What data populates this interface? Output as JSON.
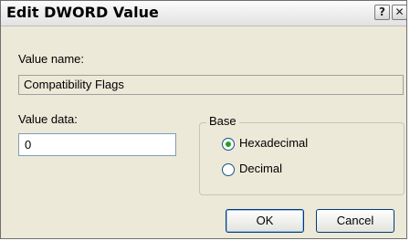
{
  "window": {
    "title": "Edit DWORD Value",
    "help_glyph": "?",
    "close_glyph": "✕"
  },
  "value_name": {
    "label": "Value name:",
    "value": "Compatibility Flags"
  },
  "value_data": {
    "label": "Value data:",
    "value": "0"
  },
  "base": {
    "legend": "Base",
    "options": [
      {
        "label": "Hexadecimal",
        "selected": true
      },
      {
        "label": "Decimal",
        "selected": false
      }
    ]
  },
  "buttons": {
    "ok": "OK",
    "cancel": "Cancel"
  },
  "colors": {
    "dialog_bg": "#ece9d8",
    "radio_dot": "#21a121",
    "button_border": "#003c74"
  }
}
